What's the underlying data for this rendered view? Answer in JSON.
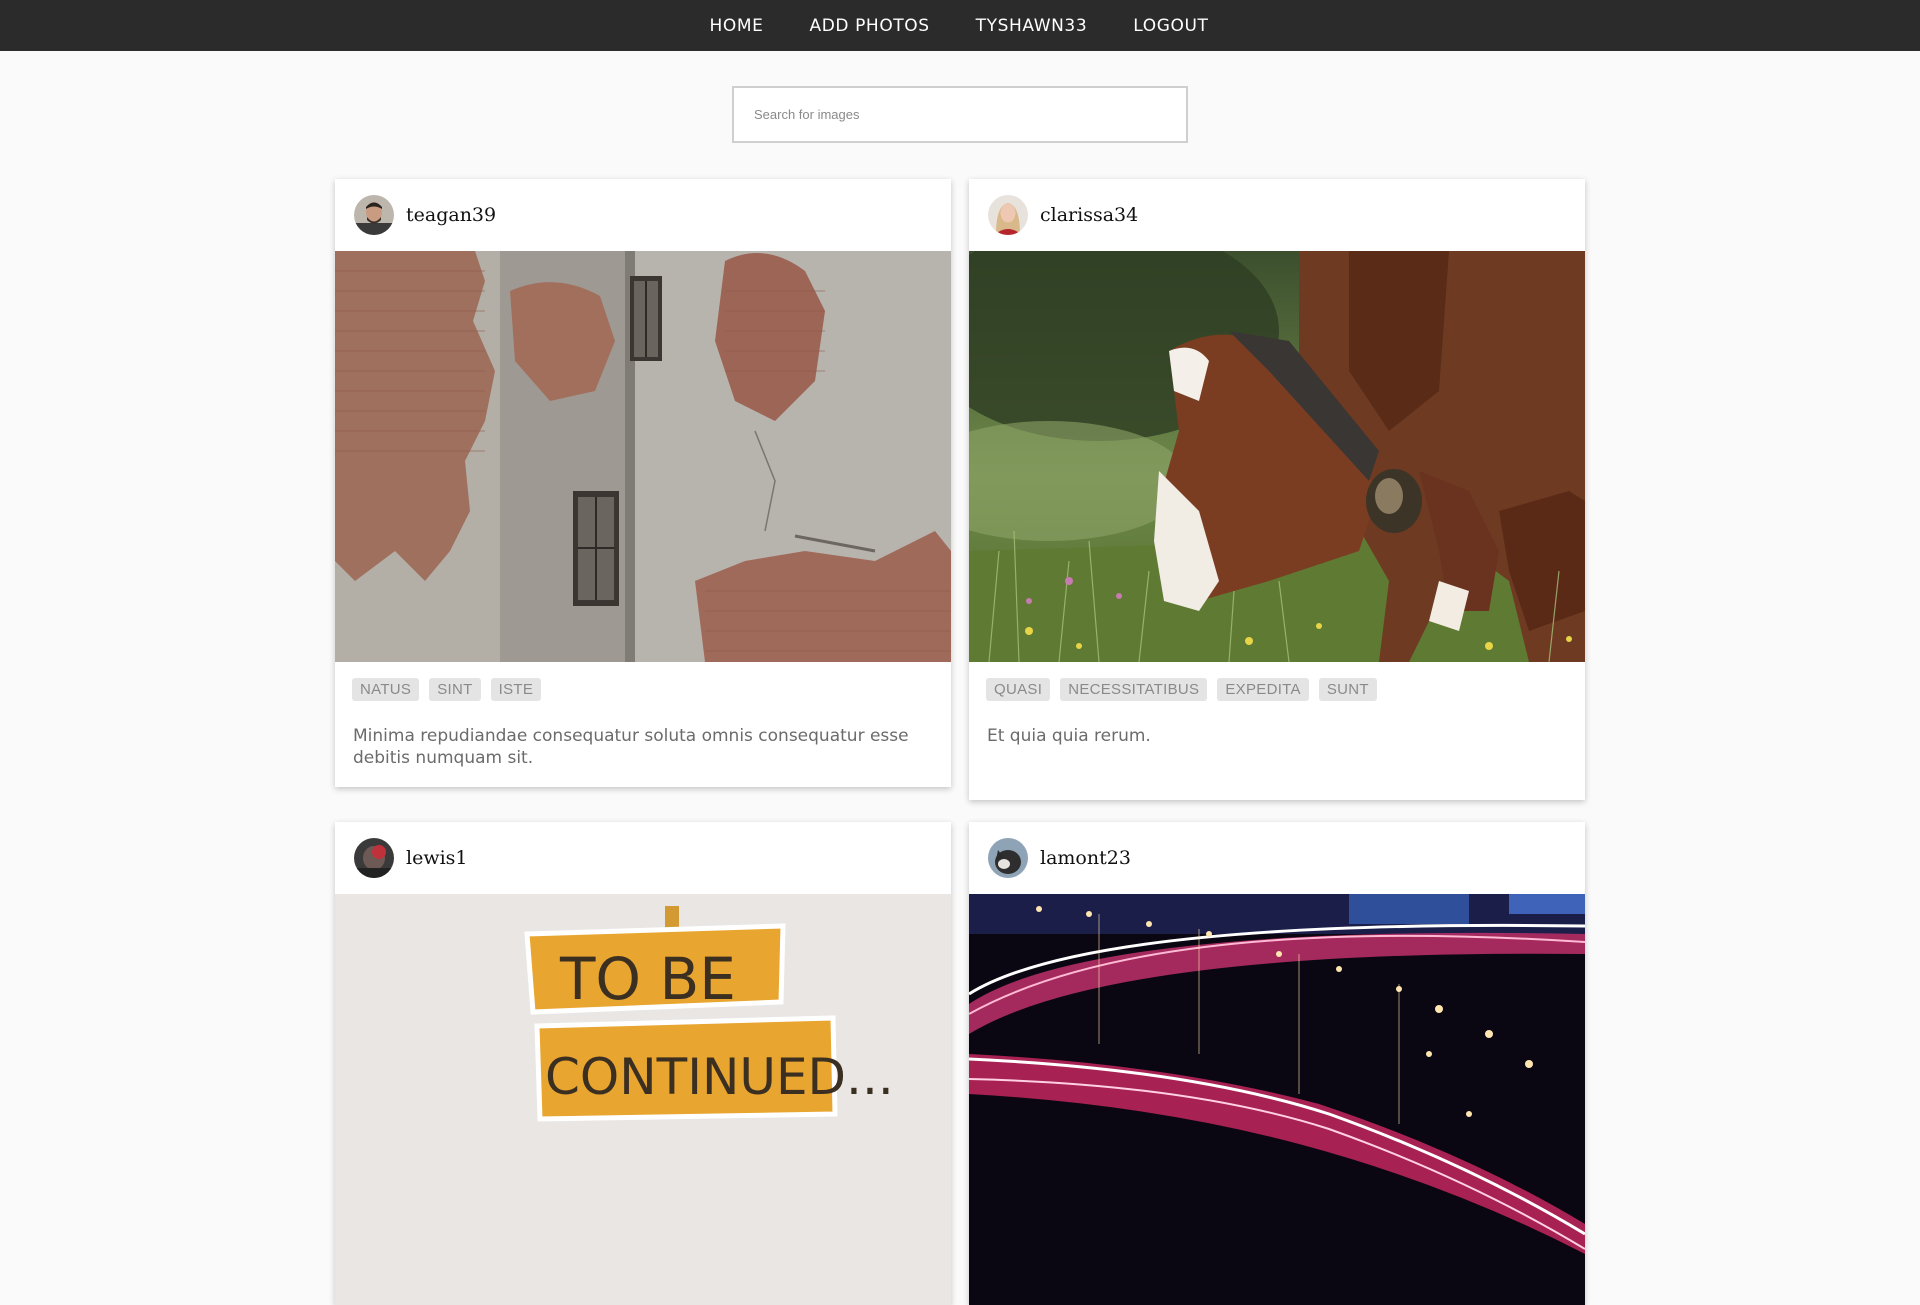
{
  "nav": {
    "items": [
      {
        "label": "HOME"
      },
      {
        "label": "ADD PHOTOS"
      },
      {
        "label": "TYSHAWN33"
      },
      {
        "label": "LOGOUT"
      }
    ]
  },
  "search": {
    "placeholder": "Search for images",
    "value": ""
  },
  "posts": [
    {
      "username": "teagan39",
      "avatar_icon": "person-avatar-icon",
      "tags": [
        "NATUS",
        "SINT",
        "ISTE"
      ],
      "caption": "Minima repudiandae consequatur soluta omnis consequatur esse debitis numquam sit."
    },
    {
      "username": "clarissa34",
      "avatar_icon": "person-avatar-icon",
      "tags": [
        "QUASI",
        "NECESSITATIBUS",
        "EXPEDITA",
        "SUNT"
      ],
      "caption": "Et quia quia rerum."
    },
    {
      "username": "lewis1",
      "avatar_icon": "person-avatar-icon",
      "photo_text": [
        "TO BE",
        "CONTINUED..."
      ],
      "tags": [],
      "caption": ""
    },
    {
      "username": "lamont23",
      "avatar_icon": "dog-avatar-icon",
      "tags": [],
      "caption": ""
    }
  ],
  "colors": {
    "nav_bg": "#2b2b2b",
    "page_bg": "#fafafa",
    "tag_bg": "#e4e4e4",
    "tag_text": "#8a8a8a",
    "caption_text": "#6b6b6b"
  }
}
